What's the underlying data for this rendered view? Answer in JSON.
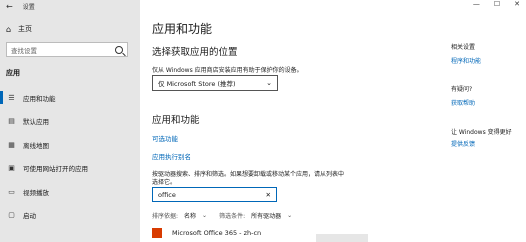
{
  "window": {
    "title": "设置",
    "controls": [
      "—",
      "☐",
      "✕"
    ]
  },
  "sidebar": {
    "home": "主页",
    "search_placeholder": "查找设置",
    "section": "应用",
    "items": [
      {
        "label": "应用和功能",
        "icon": "apps-list-icon"
      },
      {
        "label": "默认应用",
        "icon": "default-apps-icon"
      },
      {
        "label": "离线地图",
        "icon": "offline-maps-icon"
      },
      {
        "label": "可使用网站打开的应用",
        "icon": "apps-for-websites-icon"
      },
      {
        "label": "视频播放",
        "icon": "video-playback-icon"
      },
      {
        "label": "启动",
        "icon": "startup-icon"
      }
    ]
  },
  "main": {
    "title": "应用和功能",
    "choose_heading": "选择获取应用的位置",
    "choose_desc": "仅从 Windows 应用商店安装应用有助于保护你的设备。",
    "choose_value": "仅 Microsoft Store (推荐)",
    "apps_heading": "应用和功能",
    "optional_features": "可选功能",
    "app_aliases": "应用执行别名",
    "search_desc_1": "按驱动器搜索、排序和筛选。如果想要卸载或移动某个应用，请从列表中",
    "search_desc_2": "选择它。",
    "app_search_value": "office",
    "sort_label": "排序依据:",
    "sort_value": "名称",
    "filter_label": "筛选条件:",
    "filter_value": "所有驱动器",
    "app_name": "Microsoft Office 365 - zh-cn"
  },
  "aside": {
    "related_heading": "相关设置",
    "programs_link": "程序和功能",
    "question_heading": "有疑问?",
    "help_link": "获取帮助",
    "improve_heading": "让 Windows 变得更好",
    "feedback_link": "提供反馈"
  }
}
